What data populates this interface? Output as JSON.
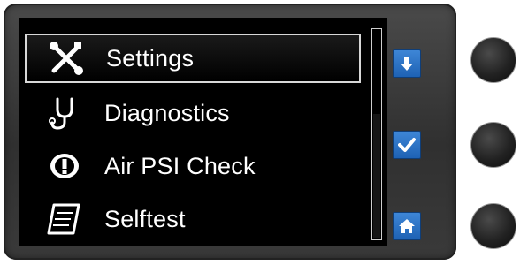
{
  "menu": {
    "items": [
      {
        "label": "Settings",
        "icon": "wrench-screwdriver-icon",
        "selected": true
      },
      {
        "label": "Diagnostics",
        "icon": "stethoscope-icon",
        "selected": false
      },
      {
        "label": "Air PSI Check",
        "icon": "pressure-warning-icon",
        "selected": false
      },
      {
        "label": "Selftest",
        "icon": "checklist-icon",
        "selected": false
      }
    ]
  },
  "side_buttons": [
    {
      "name": "scroll-down",
      "icon": "down-arrow-icon"
    },
    {
      "name": "confirm",
      "icon": "checkmark-icon"
    },
    {
      "name": "home",
      "icon": "home-icon"
    }
  ],
  "hardware_buttons": [
    "button-1",
    "button-2",
    "button-3"
  ],
  "colors": {
    "accent": "#2a73c8",
    "bezel": "#3a3a3a",
    "screen": "#000000",
    "text": "#ffffff"
  }
}
